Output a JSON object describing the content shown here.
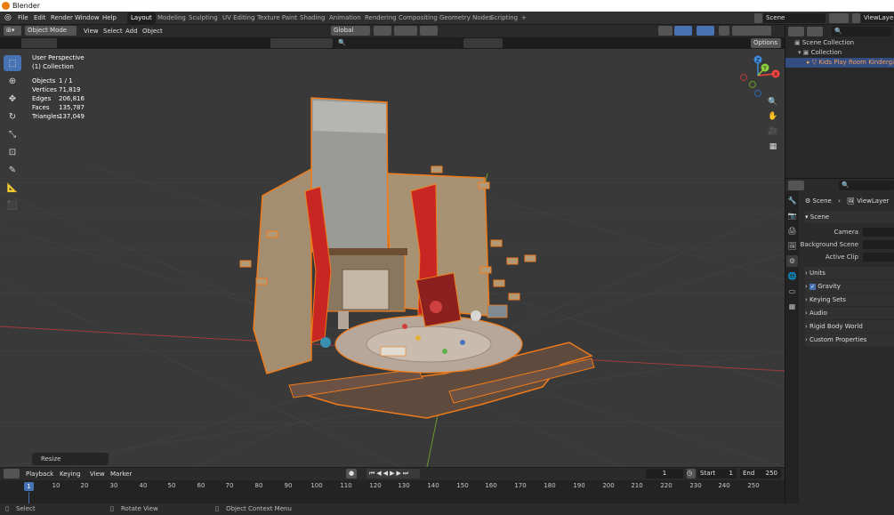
{
  "window": {
    "title": "Blender"
  },
  "menus": [
    "File",
    "Edit",
    "Render",
    "Window",
    "Help"
  ],
  "workspaces": [
    "Layout",
    "Modeling",
    "Sculpting",
    "UV Editing",
    "Texture Paint",
    "Shading",
    "Animation",
    "Rendering",
    "Compositing",
    "Geometry Nodes",
    "Scripting"
  ],
  "active_workspace": "Layout",
  "add_workspace": "+",
  "scene_name": "Scene",
  "view_layer": "ViewLayer",
  "viewport_header": {
    "mode": "Object Mode",
    "menus": [
      "View",
      "Select",
      "Add",
      "Object"
    ],
    "orientation": "Global",
    "options": "Options"
  },
  "viewport_stats": {
    "view_name": "User Perspective",
    "collection": "(1) Collection",
    "rows": [
      {
        "label": "Objects",
        "value": "1 / 1"
      },
      {
        "label": "Vertices",
        "value": "71,819"
      },
      {
        "label": "Edges",
        "value": "206,816"
      },
      {
        "label": "Faces",
        "value": "135,787"
      },
      {
        "label": "Triangles",
        "value": "137,049"
      }
    ]
  },
  "gizmo": {
    "x": "X",
    "y": "Y",
    "z": "Z"
  },
  "resize_panel": "Resize",
  "outliner": {
    "scene_collection": "Scene Collection",
    "collection": "Collection",
    "object": "Kids Play Room Kindergarten"
  },
  "properties": {
    "breadcrumb_scene": "Scene",
    "breadcrumb_viewlayer": "ViewLayer",
    "section_scene": "Scene",
    "fields": [
      {
        "label": "Camera"
      },
      {
        "label": "Background Scene"
      },
      {
        "label": "Active Clip"
      }
    ],
    "panels": [
      "Units",
      "Gravity",
      "Keying Sets",
      "Audio",
      "Rigid Body World",
      "Custom Properties"
    ],
    "gravity_checked": true
  },
  "timeline": {
    "menus": [
      "Playback",
      "Keying",
      "View",
      "Marker"
    ],
    "current_frame": "1",
    "start_label": "Start",
    "start": "1",
    "end_label": "End",
    "end": "250",
    "playhead": "1",
    "ticks": [
      "10",
      "20",
      "30",
      "40",
      "50",
      "60",
      "70",
      "80",
      "90",
      "100",
      "110",
      "120",
      "130",
      "140",
      "150",
      "160",
      "170",
      "180",
      "190",
      "200",
      "210",
      "220",
      "230",
      "240",
      "250"
    ]
  },
  "statusbar": {
    "select": "Select",
    "rotate": "Rotate View",
    "context": "Object Context Menu"
  },
  "colors": {
    "accent": "#4772b3",
    "selection_outline": "#f07b1a",
    "viewport_bg": "#393939",
    "x_axis": "#a33a3a",
    "y_axis": "#6a9a2e",
    "gizmo_x": "#f5453f",
    "gizmo_y": "#8bcf3b",
    "gizmo_z": "#3c8ad8"
  }
}
